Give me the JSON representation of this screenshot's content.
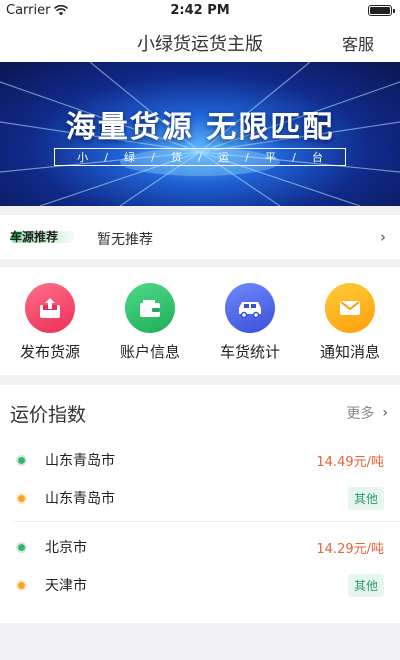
{
  "status_bar": {
    "carrier": "Carrier",
    "time": "2:42 PM"
  },
  "nav": {
    "title": "小绿货运货主版",
    "service": "客服"
  },
  "banner": {
    "headline": "海量货源 无限匹配",
    "subtitle_chars": [
      "小",
      "/",
      "绿",
      "/",
      "货",
      "/",
      "运",
      "/",
      "平",
      "/",
      "台"
    ]
  },
  "recommendation": {
    "tag": "车源推荐",
    "text": "暂无推荐",
    "chevron": "›"
  },
  "actions": [
    {
      "label": "发布货源",
      "icon": "upload-tray-icon",
      "color": "#f0466a"
    },
    {
      "label": "账户信息",
      "icon": "wallet-icon",
      "color": "#2fbf6a"
    },
    {
      "label": "车货统计",
      "icon": "truck-icon",
      "color": "#4a63e8"
    },
    {
      "label": "通知消息",
      "icon": "envelope-icon",
      "color": "#ffb11b"
    }
  ],
  "price_index": {
    "title": "运价指数",
    "more": "更多",
    "more_chevron": "›",
    "routes": [
      {
        "origin": "山东青岛市",
        "destination": "山东青岛市",
        "price": "14.49元/吨",
        "tag": "其他"
      },
      {
        "origin": "北京市",
        "destination": "天津市",
        "price": "14.29元/吨",
        "tag": "其他"
      }
    ]
  }
}
